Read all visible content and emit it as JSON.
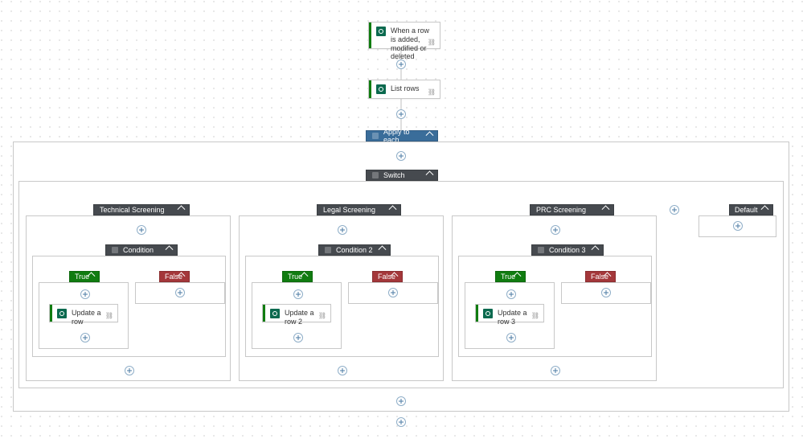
{
  "trigger": {
    "label": "When a row is added, modified or deleted"
  },
  "listRows": {
    "label": "List rows"
  },
  "applyToEach": {
    "label": "Apply to each"
  },
  "switch": {
    "label": "Switch"
  },
  "default": {
    "label": "Default"
  },
  "cases": [
    {
      "label": "Technical Screening",
      "condition": "Condition",
      "trueLabel": "True",
      "falseLabel": "False",
      "action": "Update a row"
    },
    {
      "label": "Legal Screening",
      "condition": "Condition 2",
      "trueLabel": "True",
      "falseLabel": "False",
      "action": "Update a row 2"
    },
    {
      "label": "PRC Screening",
      "condition": "Condition 3",
      "trueLabel": "True",
      "falseLabel": "False",
      "action": "Update a row 3"
    }
  ]
}
